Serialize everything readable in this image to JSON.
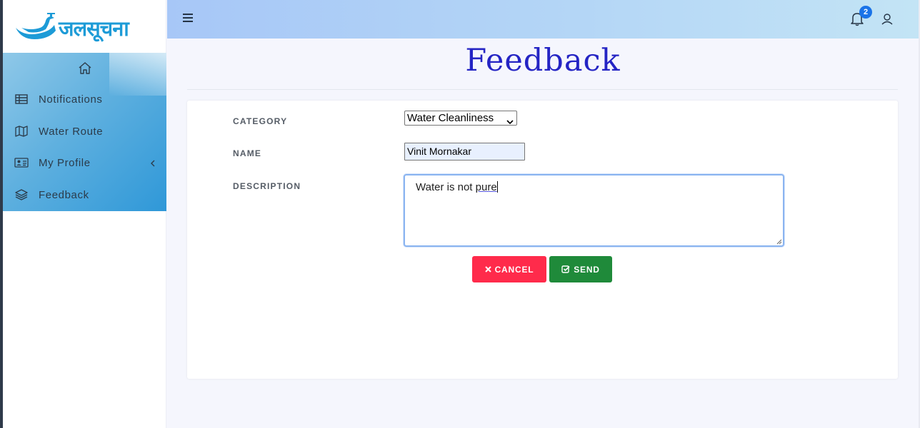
{
  "brand": {
    "logo_text": "जलसूचना",
    "logo_icon": "swan-tap-logo-icon",
    "color": "#1d9bd7"
  },
  "sidebar": {
    "home_icon": "home-icon",
    "items": [
      {
        "label": "Notifications",
        "icon": "table-icon"
      },
      {
        "label": "Water Route",
        "icon": "map-icon"
      },
      {
        "label": "My Profile",
        "icon": "id-card-icon",
        "chevron": "chevron-left-icon"
      },
      {
        "label": "Feedback",
        "icon": "layers-icon"
      }
    ]
  },
  "topbar": {
    "menu_icon": "hamburger-icon",
    "notifications": {
      "icon": "bell-icon",
      "count": "2"
    },
    "user_icon": "user-icon"
  },
  "page": {
    "title": "Feedback"
  },
  "form": {
    "category": {
      "label": "CATEGORY",
      "value": "Water Cleanliness"
    },
    "name": {
      "label": "NAME",
      "value": "Vinit Mornakar"
    },
    "description": {
      "label": "DESCRIPTION",
      "value_prefix": "Water is not ",
      "value_spell": "pure"
    },
    "cancel_label": "CANCEL",
    "send_label": "SEND"
  },
  "colors": {
    "title": "#2424c4",
    "cancel": "#ff2b4b",
    "send": "#1f8a3a",
    "badge": "#1a73e8"
  }
}
